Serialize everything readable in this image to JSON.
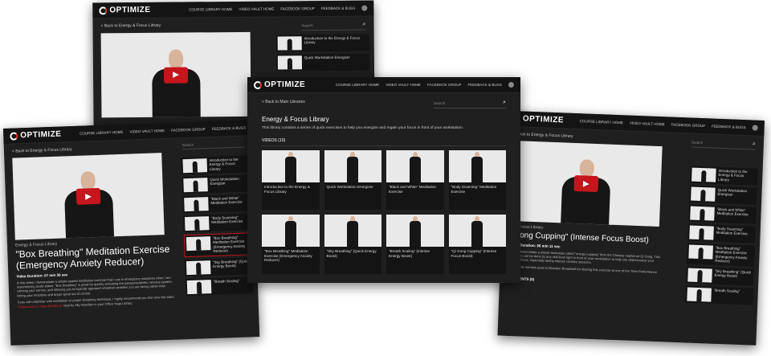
{
  "nav": {
    "logo": "OPTIMIZE",
    "logo_sub": "COURSES",
    "items": [
      "COURSE LIBRARY HOME",
      "VIDEO VAULT HOME",
      "FACEBOOK GROUP",
      "FEEDBACK & BUGS"
    ]
  },
  "back_screen": {
    "back_link": "< Back to Energy & Focus Library",
    "search_placeholder": "Search",
    "side": [
      "Introduction to the Energy & Focus Library",
      "Quick Workstation Energizer"
    ]
  },
  "left_screen": {
    "back_link": "< Back to Energy & Focus Library",
    "search_placeholder": "Search",
    "course_label": "Energy & Focus Library",
    "title": "\"Box Breathing\" Meditation Exercise (Emergency Anxiety Reducer)",
    "duration": "Video Duration: 07 min 30 sec",
    "para1": "In this video I demonstrate a simple seated meditation exercise that I use in emergency situations when I am experiencing acute stress. \"Box breathing\" is great for quickly activating the parasympathetic nervous system, calming your nerves, and allowing you to logically approach whatever problem you are facing rather than letting your emotions and anger spiral out of control.",
    "para2a": "If you are unfamiliar with meditation or proper breathing technique, I highly recommend you first view the video ",
    "para2_link": "\"Introduction to Yoga Breathing\"",
    "para2b": " lead by Ally Hamilton in your Office Yoga Library.",
    "side": [
      "Introduction to the Energy & Focus Library",
      "Quick Workstation Energizer",
      "\"Black and White\" Meditation Exercise",
      "\"Body Scanning\" Meditation Exercise",
      "\"Box Breathing\" Meditation Exercise (Emergency Anxiety Reducer)",
      "\"Sky Breathing\" (Quick Energy Boost)",
      "\"Breath Scaling\""
    ]
  },
  "right_screen": {
    "back_link": "< Back to Energy & Focus Library",
    "search_placeholder": "Search",
    "course_label": "gy & Focus Library",
    "title": "i Gong Cupping\" (Intense Focus Boost)",
    "duration": "Video Duration: 06 min 11 sec",
    "para1": "video I demonstrate a simple technique called \"energy cupping\" from the Chinese martial art Qi Gong. This technique can be done by any skill level right in front of your workstation to help you depressurize your creative focus, especially during intense creative sessions.",
    "para2": "*Honorable mention goes to Brandon Broadwell for sharing this exercise at one of the Tribe Performance events.",
    "comments": "COMMENTS (0)",
    "side": [
      "Introduction to the Energy & Focus Library",
      "Quick Workstation Energizer",
      "\"Black and White\" Meditation Exercise",
      "\"Body Scanning\" Meditation Exercise",
      "\"Box Breathing\" Meditation Exercise (Emergency Anxiety Reducer)",
      "\"Sky Breathing\" (Quick Energy Boost)",
      "\"Breath Scaling\""
    ]
  },
  "front_screen": {
    "back_link": "< Back to Main Libraries",
    "search_placeholder": "Search",
    "title": "Energy & Focus Library",
    "description": "This library contains a series of quick exercises to help you energize and regain your focus in front of your workstation.",
    "videos_header": "VIDEOS (10)",
    "videos": [
      "Introduction to the Energy & Focus Library",
      "Quick Workstation Energizer",
      "\"Black and White\" Meditation Exercise",
      "\"Body Scanning\" Meditation Exercise",
      "\"Box Breathing\" Meditation Exercise (Emergency Anxiety Reducer)",
      "\"Sky Breathing\" (Quick Energy Boost)",
      "\"Breath Scaling\" (Intense Energy Boost)",
      "\"Qi Gong Cupping\" (Intense Focus Boost)"
    ]
  }
}
